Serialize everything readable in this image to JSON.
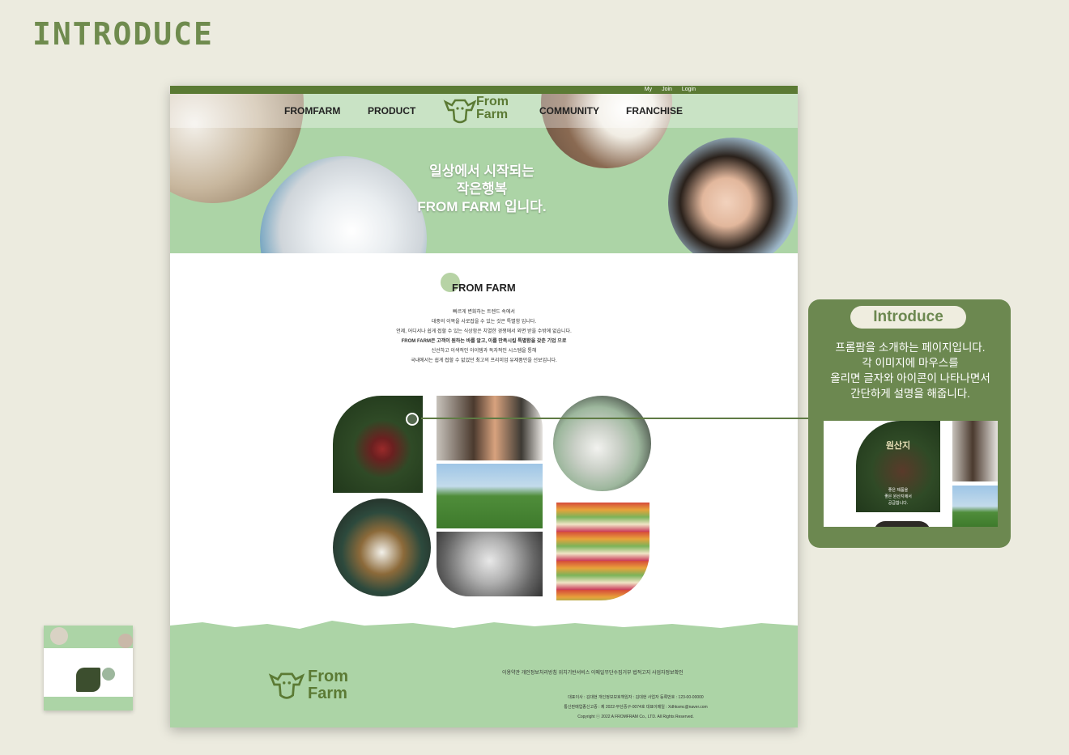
{
  "heading": "INTRODUCE",
  "util_links": [
    "My",
    "Join",
    "Login"
  ],
  "nav": {
    "fromfarm": "FROMFARM",
    "product": "PRODUCT",
    "community": "COMMUNITY",
    "franchise": "FRANCHISE"
  },
  "logo": {
    "line1": "From",
    "line2": "Farm"
  },
  "hero": {
    "line1": "일상에서 시작되는",
    "line2": "작은행복",
    "line3": "FROM FARM 입니다."
  },
  "section_title": "FROM FARM",
  "paragraph": [
    "빠르게 변화하는 트렌드 속에서",
    "대중의 이목을 사로잡을 수 있는 것은 특별함 입니다.",
    "언제, 어디서나 쉽게 접할 수 있는 식상함은 치열한 경쟁에서 외면 받을 수밖에 없습니다.",
    "FROM FARM은 고객이 원하는 바를 알고, 이를 만족시킬 특별함을 갖춘 기업 으로",
    "신선하고 이색적인 아이템과 독자적인 시스템을 통해",
    "국내에서는 쉽게 접할 수 없었던 최고의 프리미엄 유제품만을 선보입니다."
  ],
  "footer": {
    "links": "이용약관  개인정보처리방침  위치기반서비스  이메일무단수집거부  법적고지  사업자정보확인",
    "info1": "대표이사 : 김대현 개인정보보호책임자 : 김대현 사업자 등록번호 : 123-00-00000",
    "info2": "통신판매업종신고증 : 제 2022-부산중구-0074호 대표이메일 : Xdhksmc@naver.com",
    "copyright": "Copyright ⓒ 2022 A FROMFRAM Co., LTD. All Rights Reserved."
  },
  "callout": {
    "title": "Introduce",
    "desc": [
      "프롬팜을 소개하는 페이지입니다.",
      "각  이미지에 마우스를",
      "올리면 글자와 아이콘이 나타나면서",
      "간단하게 설명을 해줍니다."
    ],
    "preview_title": "원산지",
    "preview_text": [
      "좋은 제품을",
      "좋은 원산지에서",
      "공급합니다."
    ]
  },
  "colors": {
    "accent": "#6c8850",
    "hero_bg": "#acd4a6",
    "bar": "#5b7a34"
  }
}
